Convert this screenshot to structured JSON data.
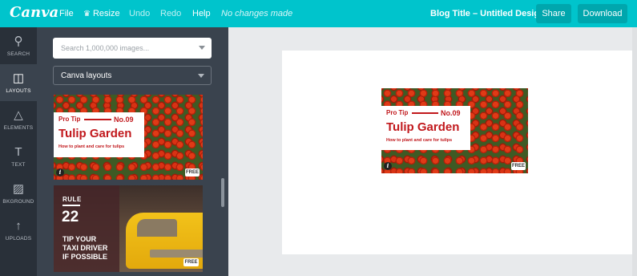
{
  "topbar": {
    "logo": "Canva",
    "menu": [
      "File",
      "Resize",
      "Undo",
      "Redo",
      "Help"
    ],
    "status": "No changes made",
    "doc_title": "Blog Title – Untitled Design",
    "share": "Share",
    "download": "Download"
  },
  "nav": [
    {
      "label": "SEARCH",
      "icon": "search-icon"
    },
    {
      "label": "LAYOUTS",
      "icon": "layouts-icon"
    },
    {
      "label": "ELEMENTS",
      "icon": "elements-icon"
    },
    {
      "label": "TEXT",
      "icon": "text-icon"
    },
    {
      "label": "BKGROUND",
      "icon": "background-icon"
    },
    {
      "label": "UPLOADS",
      "icon": "upload-icon"
    }
  ],
  "panel": {
    "search_placeholder": "Search 1,000,000 images...",
    "layouts_select": "Canva layouts"
  },
  "tulip": {
    "protip": "Pro Tip",
    "number": "No.09",
    "title": "Tulip Garden",
    "subtitle": "How to plant and care for tulips",
    "badge": "FREE",
    "info": "i"
  },
  "taxi": {
    "rule": "RULE",
    "number": "22",
    "line1": "TIP YOUR",
    "line2": "TAXI DRIVER",
    "line3": "IF POSSIBLE",
    "badge": "FREE"
  },
  "colors": {
    "topbar": "#00c4cc",
    "nav": "#293039",
    "panel": "#3a434e",
    "accent_red": "#c1181c"
  }
}
